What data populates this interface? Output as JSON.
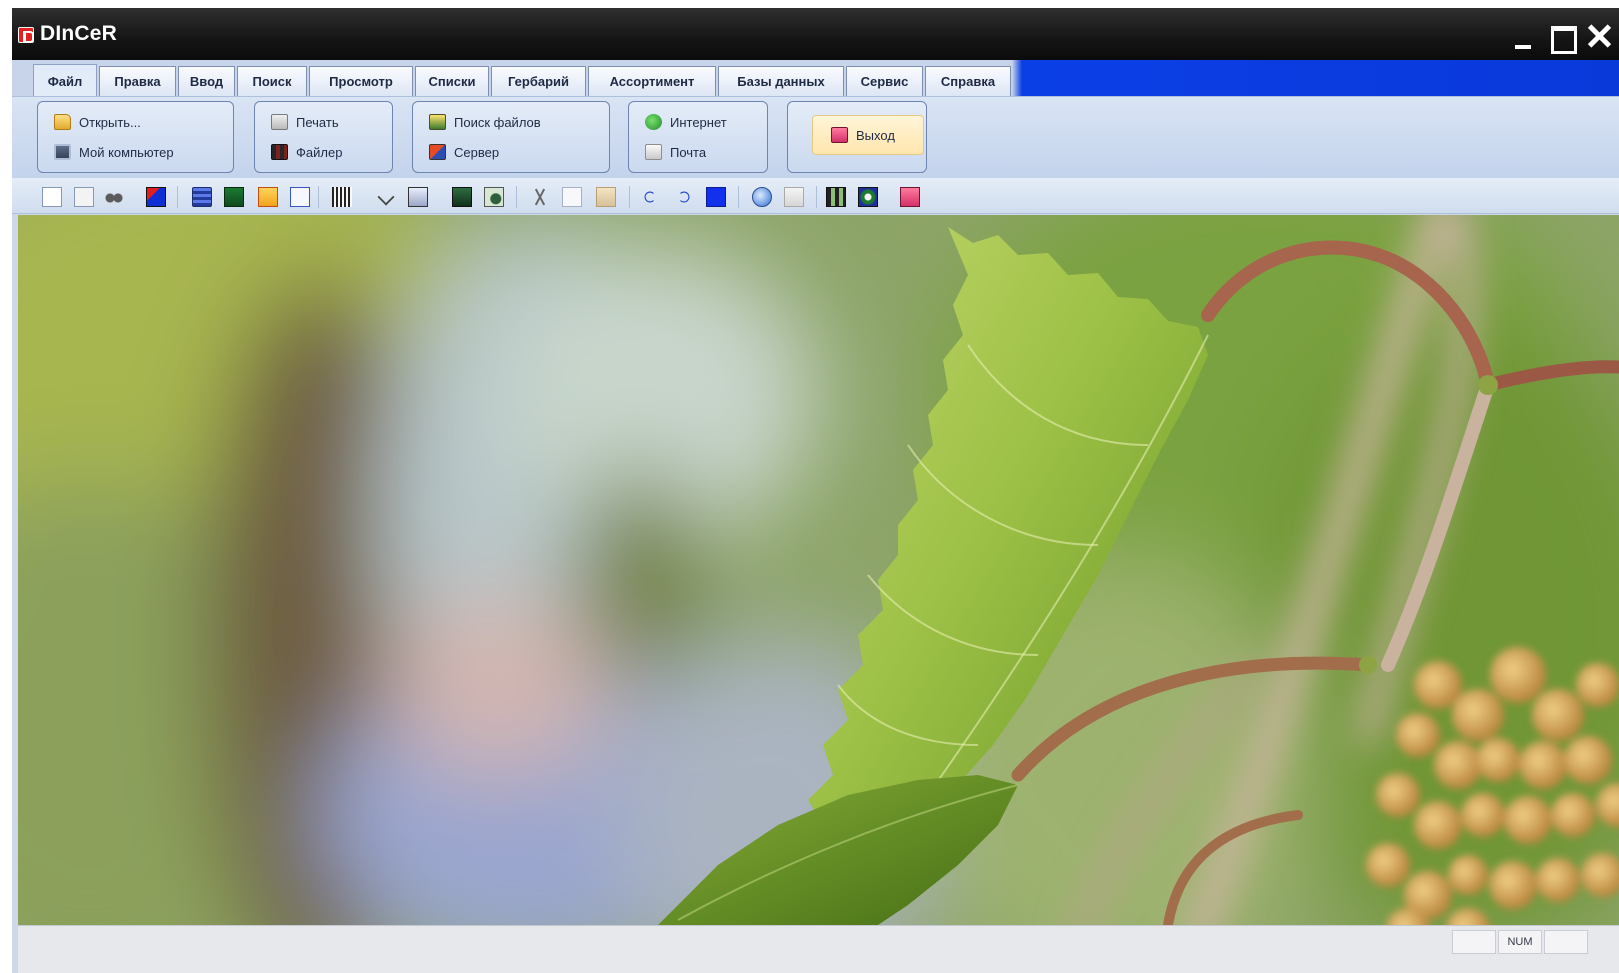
{
  "window": {
    "title": "DInCeR",
    "controls": {
      "minimize": "minimize-icon",
      "maximize": "maximize-icon",
      "close": "close-icon"
    }
  },
  "ribbon": {
    "tabs": [
      {
        "label": "Файл"
      },
      {
        "label": "Правка"
      },
      {
        "label": "Ввод"
      },
      {
        "label": "Поиск"
      },
      {
        "label": "Просмотр"
      },
      {
        "label": "Списки"
      },
      {
        "label": "Гербарий"
      },
      {
        "label": "Ассортимент"
      },
      {
        "label": "Базы данных"
      },
      {
        "label": "Сервис"
      },
      {
        "label": "Справка"
      }
    ],
    "groups": {
      "open": {
        "open": "Открыть...",
        "computer": "Мой компьютер"
      },
      "print": {
        "print": "Печать",
        "filer": "Файлер"
      },
      "search": {
        "search_files": "Поиск файлов",
        "server": "Сервер"
      },
      "net": {
        "internet": "Интернет",
        "mail": "Почта"
      },
      "exit": {
        "exit": "Выход"
      }
    },
    "accent_color": "#0b3fe6"
  },
  "toolbar": {
    "icons": [
      "new-document-icon",
      "open-document-icon",
      "find-icon",
      "form-icon",
      "list-icon",
      "table-icon",
      "note-icon",
      "text-icon",
      "barcode-icon",
      "check-icon",
      "report-icon",
      "window-icon",
      "preview-icon",
      "cut-icon",
      "copy-icon",
      "paste-icon",
      "undo-icon",
      "redo-icon",
      "color-icon",
      "web-icon",
      "mail-icon",
      "grid-icon",
      "target-icon",
      "exit-icon"
    ]
  },
  "content": {
    "background": "nature-photo-birch-leaves"
  },
  "statusbar": {
    "panes": [
      "",
      "NUM"
    ]
  }
}
